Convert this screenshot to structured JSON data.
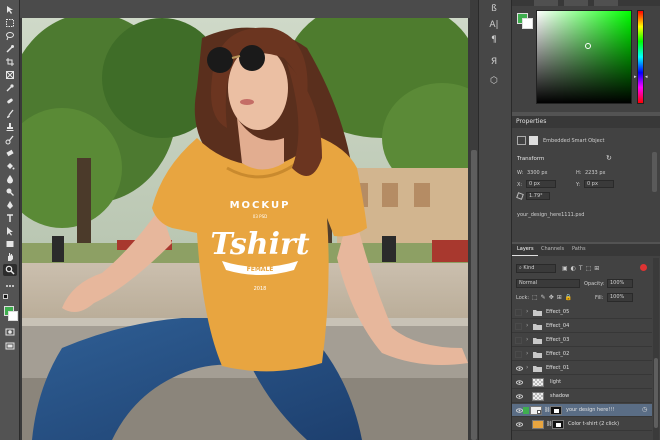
{
  "panels": {
    "properties": {
      "tab": "Properties",
      "object_type": "Embedded Smart Object",
      "transform_title": "Transform",
      "w_label": "W:",
      "w_value": "3300 px",
      "h_label": "H:",
      "h_value": "2233 px",
      "x_label": "X:",
      "x_value": "0 px",
      "y_label": "Y:",
      "y_value": "0 px",
      "angle_value": "1.79°",
      "filename": "your_design_here1111.psd"
    },
    "layers": {
      "tabs": [
        "Layers",
        "Channels",
        "Paths"
      ],
      "filter_kind": "Kind",
      "blend_mode": "Normal",
      "opacity_label": "Opacity:",
      "opacity_value": "100%",
      "lock_label": "Lock:",
      "fill_label": "Fill:",
      "fill_value": "100%",
      "items": [
        {
          "name": "Effect_05",
          "kind": "folder",
          "visible": false
        },
        {
          "name": "Effect_04",
          "kind": "folder",
          "visible": false
        },
        {
          "name": "Effect_03",
          "kind": "folder",
          "visible": false
        },
        {
          "name": "Effect_02",
          "kind": "folder",
          "visible": false
        },
        {
          "name": "Effect_01",
          "kind": "folder",
          "visible": true
        },
        {
          "name": "light",
          "kind": "layer",
          "visible": true
        },
        {
          "name": "shadow",
          "kind": "layer",
          "visible": true
        },
        {
          "name": "your design here!!!",
          "kind": "smart",
          "visible": true,
          "selected": true
        },
        {
          "name": "Color t-shirt (2 click)",
          "kind": "fill",
          "visible": true
        }
      ]
    }
  },
  "canvas": {
    "shirt_text": {
      "line1": "MOCKUP",
      "line2": "03 PSD",
      "line3": "Tshirt",
      "line4": "FEMALE",
      "line5": "2018"
    }
  },
  "colors": {
    "shirt": "#e8a540",
    "selection": "#5a6d85",
    "foreground_swatch": "#3fae4f"
  }
}
